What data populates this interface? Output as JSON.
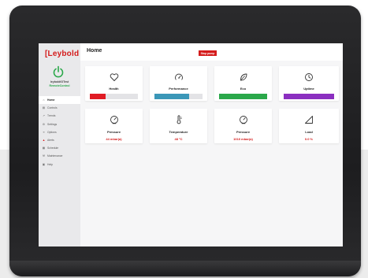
{
  "sidebar": {
    "logo_text": "Leybold",
    "device_name": "leyboldIOTest",
    "device_status": "RemoteControl",
    "items": [
      {
        "label": "Home",
        "icon": "home-icon",
        "glyph": "⌂",
        "active": true
      },
      {
        "label": "Controls",
        "icon": "controls-icon",
        "glyph": "▤",
        "active": false
      },
      {
        "label": "Trends",
        "icon": "trends-icon",
        "glyph": "↗",
        "active": false
      },
      {
        "label": "Settings",
        "icon": "settings-icon",
        "glyph": "⚙",
        "active": false
      },
      {
        "label": "Options",
        "icon": "options-icon",
        "glyph": "≡",
        "active": false
      },
      {
        "label": "Alerts",
        "icon": "alert-icon",
        "glyph": "▲",
        "active": false
      },
      {
        "label": "Schedule",
        "icon": "calendar-icon",
        "glyph": "▦",
        "active": false
      },
      {
        "label": "Maintenance",
        "icon": "wrench-icon",
        "glyph": "⚒",
        "active": false
      },
      {
        "label": "Help",
        "icon": "help-icon",
        "glyph": "▣",
        "active": false
      }
    ]
  },
  "header": {
    "title": "Home",
    "stop_label": "Stop pump"
  },
  "status_cards": [
    {
      "title": "Health",
      "icon": "heart-icon",
      "color": "#e01b24",
      "level": 0.32
    },
    {
      "title": "Performance",
      "icon": "gauge-icon",
      "color": "#3b97b8",
      "level": 0.72
    },
    {
      "title": "Eco",
      "icon": "leaf-icon",
      "color": "#2aa84a",
      "level": 1.0
    },
    {
      "title": "Uptime",
      "icon": "clock-icon",
      "color": "#8b2fc0",
      "level": 1.0
    }
  ],
  "value_cards": [
    {
      "title": "Pressure",
      "value": "44 mbar(a)",
      "icon": "pressure-gauge-icon"
    },
    {
      "title": "Temperature",
      "value": "48 °C",
      "icon": "thermometer-icon"
    },
    {
      "title": "Pressure",
      "value": "1010 mbar(a)",
      "icon": "pressure-gauge-icon"
    },
    {
      "title": "Load",
      "value": "0.0 %",
      "icon": "load-triangle-icon"
    }
  ],
  "colors": {
    "brand_red": "#d41b1b",
    "status_green": "#2aa84a",
    "sidebar_bg": "#e9e9eb"
  }
}
